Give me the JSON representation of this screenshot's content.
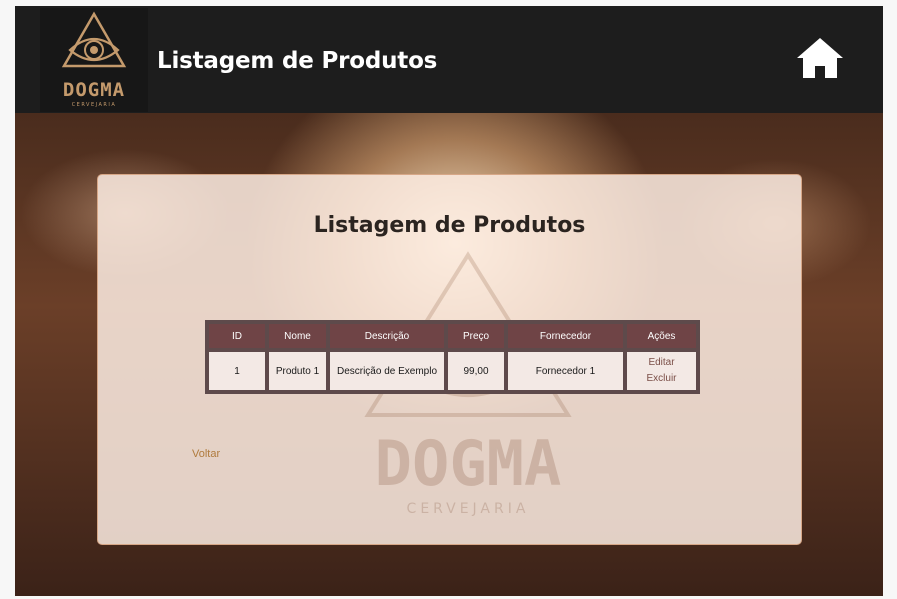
{
  "header": {
    "title": "Listagem de Produtos",
    "logo": {
      "brand": "DOGMA",
      "sub": "CERVEJARIA"
    },
    "home_icon": "home-icon"
  },
  "card": {
    "title": "Listagem de Produtos",
    "watermark": {
      "brand": "DOGMA",
      "sub": "CERVEJARIA"
    }
  },
  "table": {
    "headers": [
      "ID",
      "Nome",
      "Descrição",
      "Preço",
      "Fornecedor",
      "Ações"
    ],
    "rows": [
      {
        "id": "1",
        "nome": "Produto 1",
        "descricao": "Descrição de Exemplo",
        "preco": "99,00",
        "fornecedor": "Fornecedor 1",
        "acoes": {
          "edit": "Editar",
          "delete": "Excluir"
        }
      }
    ]
  },
  "back_link": "Voltar",
  "colors": {
    "header_bg": "#1d1d1d",
    "table_header": "#6f4446",
    "accent": "#b07b3d",
    "card_bg": "#fdece2"
  }
}
